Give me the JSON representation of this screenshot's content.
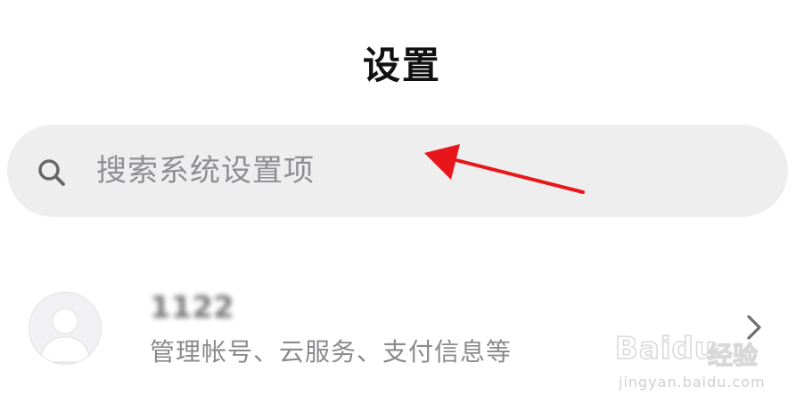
{
  "header": {
    "title": "设置"
  },
  "search": {
    "placeholder": "搜索系统设置项",
    "value": "",
    "icon": "search-icon"
  },
  "annotation": {
    "arrow_color": "#e8161a"
  },
  "account": {
    "name": "1122",
    "subtitle": "管理帐号、云服务、支付信息等",
    "avatar_icon": "user-avatar-icon",
    "chevron_icon": "chevron-right-icon"
  },
  "watermark": {
    "logo": "Baidu",
    "product": "经验",
    "url": "jingyan.baidu.com"
  }
}
